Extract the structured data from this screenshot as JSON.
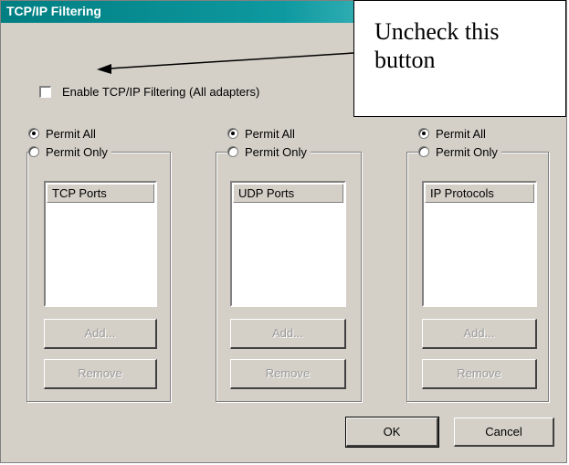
{
  "dialog": {
    "title": "TCP/IP Filtering"
  },
  "enable_filtering": {
    "label": "Enable TCP/IP Filtering (All adapters)",
    "checked": false
  },
  "groups": [
    {
      "permit_all": "Permit All",
      "permit_only": "Permit Only",
      "selected": "permit_all",
      "list_header": "TCP Ports",
      "add_label": "Add...",
      "remove_label": "Remove"
    },
    {
      "permit_all": "Permit All",
      "permit_only": "Permit Only",
      "selected": "permit_all",
      "list_header": "UDP Ports",
      "add_label": "Add...",
      "remove_label": "Remove"
    },
    {
      "permit_all": "Permit All",
      "permit_only": "Permit Only",
      "selected": "permit_all",
      "list_header": "IP Protocols",
      "add_label": "Add...",
      "remove_label": "Remove"
    }
  ],
  "buttons": {
    "ok": "OK",
    "cancel": "Cancel"
  },
  "annotation": {
    "text": "Uncheck this button"
  },
  "colors": {
    "titlebar_start": "#007f82",
    "titlebar_end": "#8fe3e6",
    "face": "#d4d0c8"
  }
}
